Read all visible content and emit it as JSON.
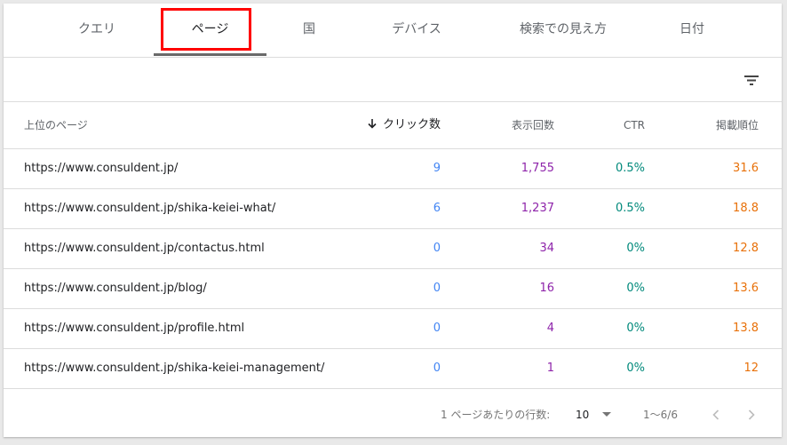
{
  "tabs": [
    {
      "label": "クエリ"
    },
    {
      "label": "ページ"
    },
    {
      "label": "国"
    },
    {
      "label": "デバイス"
    },
    {
      "label": "検索での見え方"
    },
    {
      "label": "日付"
    }
  ],
  "table": {
    "headers": {
      "page": "上位のページ",
      "clicks": "クリック数",
      "impressions": "表示回数",
      "ctr": "CTR",
      "position": "掲載順位"
    },
    "rows": [
      {
        "url": "https://www.consuldent.jp/",
        "clicks": "9",
        "impressions": "1,755",
        "ctr": "0.5%",
        "position": "31.6"
      },
      {
        "url": "https://www.consuldent.jp/shika-keiei-what/",
        "clicks": "6",
        "impressions": "1,237",
        "ctr": "0.5%",
        "position": "18.8"
      },
      {
        "url": "https://www.consuldent.jp/contactus.html",
        "clicks": "0",
        "impressions": "34",
        "ctr": "0%",
        "position": "12.8"
      },
      {
        "url": "https://www.consuldent.jp/blog/",
        "clicks": "0",
        "impressions": "16",
        "ctr": "0%",
        "position": "13.6"
      },
      {
        "url": "https://www.consuldent.jp/profile.html",
        "clicks": "0",
        "impressions": "4",
        "ctr": "0%",
        "position": "13.8"
      },
      {
        "url": "https://www.consuldent.jp/shika-keiei-management/",
        "clicks": "0",
        "impressions": "1",
        "ctr": "0%",
        "position": "12"
      }
    ]
  },
  "footer": {
    "rows_per_page_label": "1 ページあたりの行数:",
    "rows_per_page_value": "10",
    "range": "1〜6/6"
  },
  "colors": {
    "clicks": "#4285f4",
    "impressions": "#8e24aa",
    "ctr": "#00897b",
    "position": "#e8710a",
    "highlight": "#ff0000"
  },
  "icons": {
    "filter": "filter-icon",
    "sort": "arrow-down-icon",
    "prev": "chevron-left-icon",
    "next": "chevron-right-icon",
    "dropdown": "caret-down-icon"
  }
}
